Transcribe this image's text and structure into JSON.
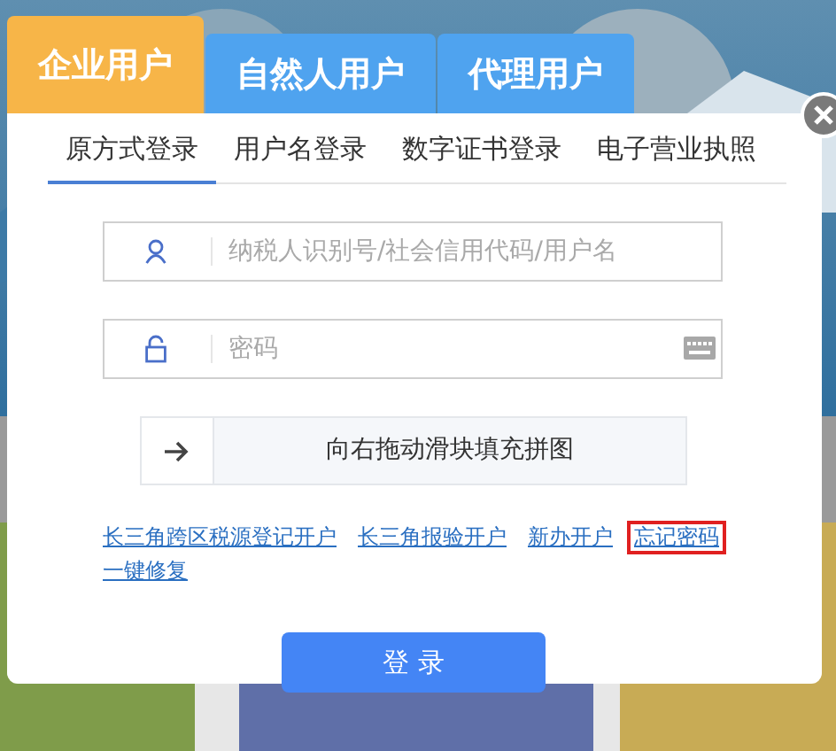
{
  "user_tabs": [
    {
      "label": "企业用户",
      "selected": true
    },
    {
      "label": "自然人用户",
      "selected": false
    },
    {
      "label": "代理用户",
      "selected": false
    }
  ],
  "login_methods": [
    {
      "label": "原方式登录",
      "selected": true
    },
    {
      "label": "用户名登录",
      "selected": false
    },
    {
      "label": "数字证书登录",
      "selected": false
    },
    {
      "label": "电子营业执照",
      "selected": false
    }
  ],
  "fields": [
    {
      "kind": "user",
      "placeholder": "纳税人识别号/社会信用代码/用户名"
    },
    {
      "kind": "password",
      "placeholder": "密码"
    }
  ],
  "slider_captcha": {
    "hint": "向右拖动滑块填充拼图"
  },
  "links": [
    {
      "label": "长三角跨区税源登记开户",
      "highlighted": false
    },
    {
      "label": "长三角报验开户",
      "highlighted": false
    },
    {
      "label": "新办开户",
      "highlighted": false
    },
    {
      "label": "忘记密码",
      "highlighted": true
    },
    {
      "label": "一键修复",
      "highlighted": false
    }
  ],
  "login_button": "登 录"
}
